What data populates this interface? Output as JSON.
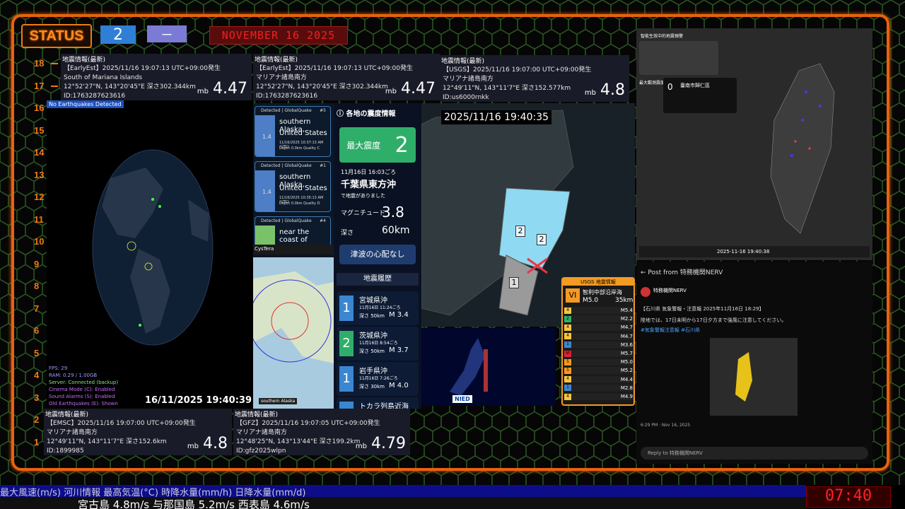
{
  "top": {
    "status_label": "STATUS",
    "level": "2",
    "mode": "ー",
    "date": "NOVEMBER 16 2025"
  },
  "ruler": [
    "18",
    "17",
    "16",
    "15",
    "14",
    "13",
    "12",
    "11",
    "10",
    "9",
    "8",
    "7",
    "6",
    "5",
    "4",
    "3",
    "2",
    "1"
  ],
  "globe": {
    "badge": "No Earthquakes Detected",
    "timestamp": "16/11/2025 19:40:39",
    "stats": [
      "FPS: 29",
      "RAM: 0.29 / 1.00GB",
      "Server: Connected (backup)",
      "Cinema Mode (C): Enabled",
      "Sound Alarms (S): Enabled",
      "Old Earthquakes (E): Shown"
    ]
  },
  "eq_top": [
    {
      "header": "地震情報(最新)",
      "source": "【EarlyEst】2025/11/16 19:07:13 UTC+09:00発生",
      "place": "South of Mariana Islands",
      "coords": "12°52'27\"N, 143°20'45\"E 深さ302.344km",
      "id": "ID:1763287623616",
      "mb": "mb",
      "mag": "4.47"
    },
    {
      "header": "地震情報(最新)",
      "source": "【EarlyEst】2025/11/16 19:07:13 UTC+09:00発生",
      "place": "マリアナ諸島南方",
      "coords": "12°52'27\"N, 143°20'45\"E 深さ302.344km",
      "id": "ID:1763287623616",
      "mb": "mb",
      "mag": "4.47"
    },
    {
      "header": "地震情報(最新)",
      "source": "【USGS】2025/11/16 19:07:00 UTC+09:00発生",
      "place": "マリアナ諸島南方",
      "coords": "12°49'11\"N, 143°11'7\"E 深さ152.577km",
      "id": "ID:us6000rnkk",
      "mb": "mb",
      "mag": "4.8"
    }
  ],
  "eq_bottom": [
    {
      "header": "地震情報(最新)",
      "source": "【EMSC】2025/11/16 19:07:00 UTC+09:00発生",
      "place": "マリアナ諸島南方",
      "coords": "12°49'11\"N, 143°11'7\"E 深さ152.6km",
      "id": "ID:1899985",
      "mb": "mb",
      "mag": "4.8"
    },
    {
      "header": "地震情報(最新)",
      "source": "【GFZ】2025/11/16 19:07:05 UTC+09:00発生",
      "place": "マリアナ諸島南方",
      "coords": "12°48'25\"N, 143°13'44\"E 深さ199.2km",
      "id": "ID:gfz2025wlpn",
      "mb": "mb",
      "mag": "4.79"
    }
  ],
  "gq": {
    "cards": [
      {
        "head": "Detected | GlobalQuake",
        "num": "#5",
        "mag": "1.4",
        "place1": "southern Alaska,",
        "place2": "United States",
        "time": "11/16/2025 10:37:13 AM (UTC)",
        "meta": "Depth 0.0km Quality C"
      },
      {
        "head": "Detected | GlobalQuake",
        "num": "#1",
        "mag": "1.4",
        "place1": "southern Alaska,",
        "place2": "United States",
        "time": "11/16/2025 10:35:13 AM (UTC)",
        "meta": "Depth 0.0km Quality D"
      },
      {
        "head": "Detected | GlobalQuake",
        "num": "#4",
        "mag": "",
        "place1": "near the coast of",
        "place2": "",
        "time": "",
        "meta": ""
      }
    ],
    "footer": "CysTera",
    "map_label": "southern Alaska"
  },
  "shindo": {
    "title": "ⓘ 各地の震度情報",
    "max_label": "最大震度",
    "max_value": "2",
    "time": "11月16日 16:03ごろ",
    "place": "千葉県東方沖",
    "note": "で地震がありました",
    "mag_label": "マグニチュード",
    "mag": "3.8",
    "depth_label": "深さ",
    "depth": "60km",
    "tsunami": "津波の心配なし",
    "history_title": "地震履歴",
    "history": [
      {
        "int": "1",
        "place": "宮城県沖",
        "time": "11月16日 11:24ごろ",
        "depth": "深さ 50km",
        "mag": "M 3.4"
      },
      {
        "int": "2",
        "place": "茨城県沖",
        "time": "11月16日 8:54ごろ",
        "depth": "深さ 50km",
        "mag": "M 3.7"
      },
      {
        "int": "1",
        "place": "岩手県沖",
        "time": "11月16日 7:26ごろ",
        "depth": "深さ 30km",
        "mag": "M 4.0"
      },
      {
        "int": "",
        "place": "トカラ列島近海",
        "time": "",
        "depth": "",
        "mag": ""
      }
    ]
  },
  "kanto": {
    "timestamp": "2025/11/16 19:40:35",
    "marker1": "2",
    "marker2": "2",
    "marker3": "1"
  },
  "nied": {
    "logo": "NIED"
  },
  "usgs": {
    "title": "USGS 地震情報",
    "level": "VI",
    "place": "智利中部沿岸海",
    "mag": "M5.0",
    "depth": "35km",
    "rows": [
      {
        "lv": "4",
        "m": "M5.4"
      },
      {
        "lv": "2",
        "m": "M2.2"
      },
      {
        "lv": "4",
        "m": "M4.7"
      },
      {
        "lv": "4",
        "m": "M4.7"
      },
      {
        "lv": "1",
        "m": "M3.6"
      },
      {
        "lv": "VI",
        "m": "M5.7"
      },
      {
        "lv": "5",
        "m": "M5.0"
      },
      {
        "lv": "5",
        "m": "M5.2"
      },
      {
        "lv": "4",
        "m": "M4.4"
      },
      {
        "lv": "1",
        "m": "M2.8"
      },
      {
        "lv": "4",
        "m": "M4.9"
      }
    ]
  },
  "taiwan": {
    "title": "智能生效中的地震預警",
    "label1": "最大觀測震度",
    "readout_value": "0",
    "readout_place": "臺南市歸仁區",
    "timestamp": "2025-11-16 19:40:38"
  },
  "post": {
    "header": "←  Post from 特務機関NERV",
    "author": "特務機関NERV",
    "line1": "【石川県 気象警報・注意報 2025年11月16日 18:29】",
    "line2": "陸地では、17日未明から17日夕方まで強風に注意してください。",
    "tags": "#気象警報注意報 #石川県",
    "time": "6:29 PM · Nov 16, 2025",
    "reply": "Reply to 特務機関NERV"
  },
  "ticker": {
    "top": "最大風速(m/s) 河川情報     最高気温(°C)     時降水量(mm/h)   日降水量(mm/d)",
    "bottom": "宮古島 4.8m/s    与那国島 5.2m/s    西表島 4.6m/s",
    "clock": "07:40"
  }
}
